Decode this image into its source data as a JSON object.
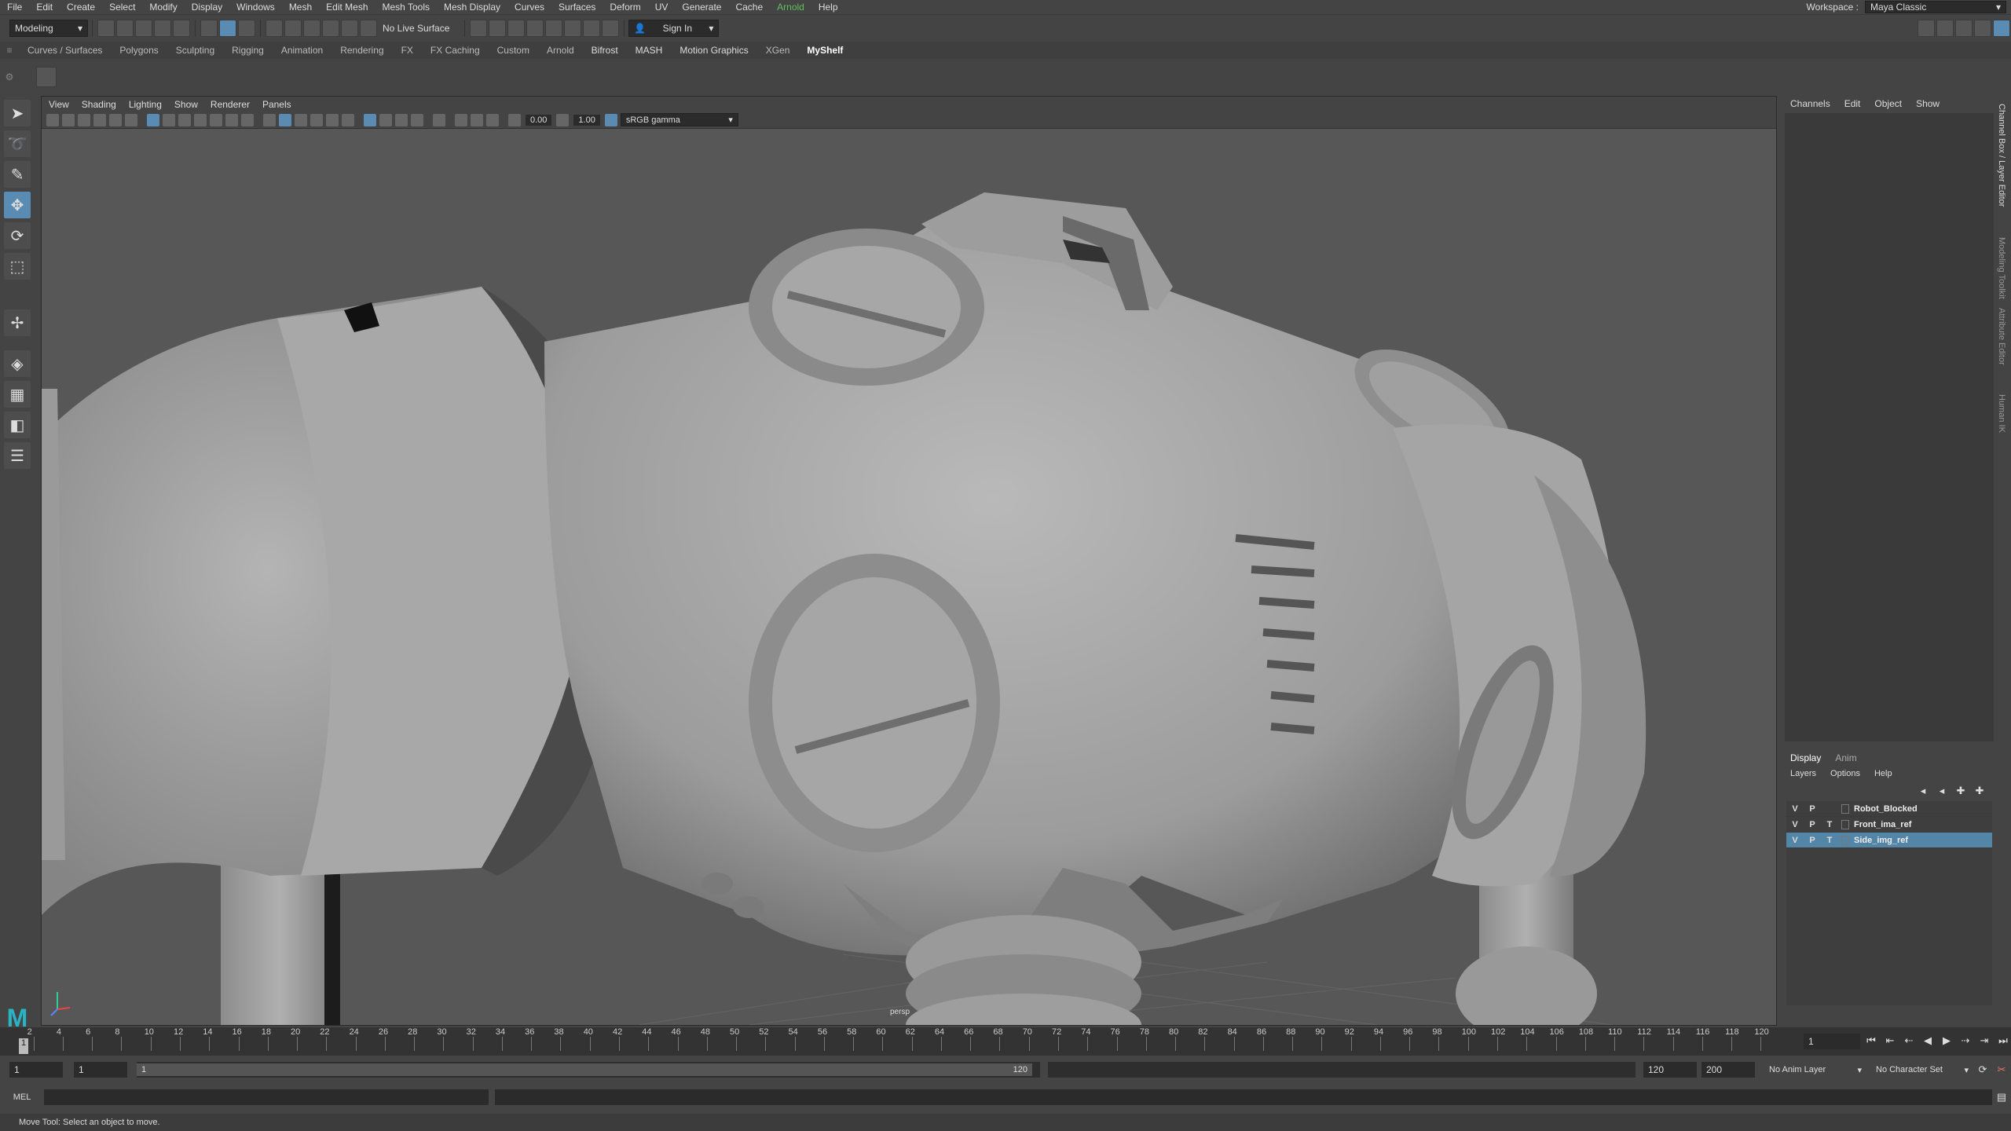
{
  "menubar": {
    "items": [
      "File",
      "Edit",
      "Create",
      "Select",
      "Modify",
      "Display",
      "Windows",
      "Mesh",
      "Edit Mesh",
      "Mesh Tools",
      "Mesh Display",
      "Curves",
      "Surfaces",
      "Deform",
      "UV",
      "Generate",
      "Cache",
      "Arnold",
      "Help"
    ],
    "workspace_label": "Workspace :",
    "workspace_value": "Maya Classic"
  },
  "statusline": {
    "mode": "Modeling",
    "live_surface": "No Live Surface",
    "sign_in": "Sign In"
  },
  "shelf": {
    "tabs": [
      "Curves / Surfaces",
      "Polygons",
      "Sculpting",
      "Rigging",
      "Animation",
      "Rendering",
      "FX",
      "FX Caching",
      "Custom",
      "Arnold",
      "Bifrost",
      "MASH",
      "Motion Graphics",
      "XGen",
      "MyShelf"
    ],
    "active_tab": "MyShelf"
  },
  "viewport": {
    "menu": [
      "View",
      "Shading",
      "Lighting",
      "Show",
      "Renderer",
      "Panels"
    ],
    "exposure": "0.00",
    "gamma": "1.00",
    "color_space": "sRGB gamma",
    "camera_label": "persp"
  },
  "channelbox": {
    "menu": [
      "Channels",
      "Edit",
      "Object",
      "Show"
    ]
  },
  "layer_editor": {
    "tabs": [
      "Display",
      "Anim"
    ],
    "menu": [
      "Layers",
      "Options",
      "Help"
    ],
    "layers": [
      {
        "v": "V",
        "p": "P",
        "t": "",
        "name": "Robot_Blocked",
        "selected": false
      },
      {
        "v": "V",
        "p": "P",
        "t": "T",
        "name": "Front_ima_ref",
        "selected": false
      },
      {
        "v": "V",
        "p": "P",
        "t": "T",
        "name": "Side_img_ref",
        "selected": true
      }
    ]
  },
  "side_tabs": [
    "Channel Box / Layer Editor",
    "Modeling Toolkit",
    "Attribute Editor",
    "Human IK"
  ],
  "timeslider": {
    "ticks": [
      "2",
      "4",
      "6",
      "8",
      "10",
      "12",
      "14",
      "16",
      "18",
      "20",
      "22",
      "24",
      "26",
      "28",
      "30",
      "32",
      "34",
      "36",
      "38",
      "40",
      "42",
      "44",
      "46",
      "48",
      "50",
      "52",
      "54",
      "56",
      "58",
      "60",
      "62",
      "64",
      "66",
      "68",
      "70",
      "72",
      "74",
      "76",
      "78",
      "80",
      "82",
      "84",
      "86",
      "88",
      "90",
      "92",
      "94",
      "96",
      "98",
      "100",
      "102",
      "104",
      "106",
      "108",
      "110",
      "112",
      "114",
      "116",
      "118",
      "120"
    ],
    "current_marker": "1",
    "current_frame": "1"
  },
  "range": {
    "start": "1",
    "playback_start": "1",
    "inner_start": "1",
    "inner_end": "120",
    "playback_end": "120",
    "end": "200",
    "anim_layer": "No Anim Layer",
    "character_set": "No Character Set"
  },
  "cmdline": {
    "lang": "MEL"
  },
  "helpline": {
    "text": "Move Tool: Select an object to move."
  }
}
